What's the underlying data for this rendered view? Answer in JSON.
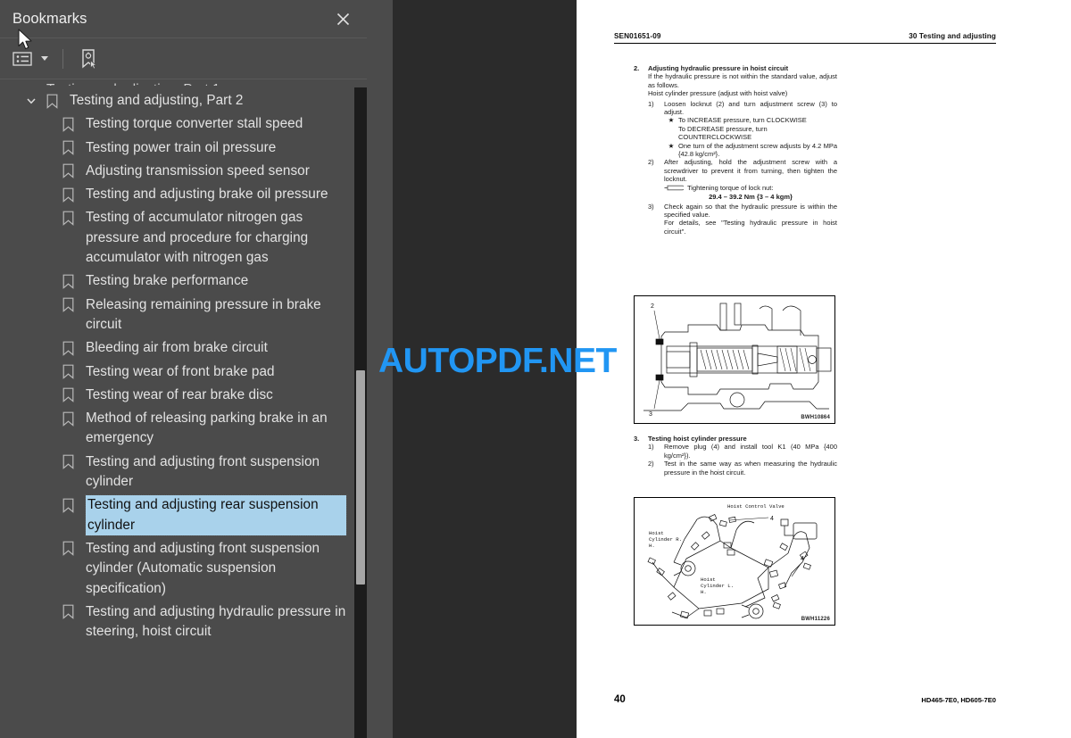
{
  "sidebar": {
    "title": "Bookmarks",
    "close_icon": "close-icon",
    "toolbar": {
      "list_options_icon": "list-options-icon",
      "dropdown_icon": "chevron-down-icon",
      "new_bookmark_icon": "new-bookmark-icon"
    },
    "items": [
      {
        "label": "Testing and adjusting, Part 2",
        "level": 0,
        "expanded": true,
        "selected": false
      },
      {
        "label": "Testing torque converter stall speed",
        "level": 1,
        "selected": false
      },
      {
        "label": "Testing power train oil pressure",
        "level": 1,
        "selected": false
      },
      {
        "label": "Adjusting transmission speed sensor",
        "level": 1,
        "selected": false
      },
      {
        "label": "Testing and adjusting brake oil pressure",
        "level": 1,
        "selected": false
      },
      {
        "label": "Testing of accumulator nitrogen gas pressure and procedure for charging accumulator with nitrogen gas",
        "level": 1,
        "selected": false
      },
      {
        "label": "Testing brake performance",
        "level": 1,
        "selected": false
      },
      {
        "label": "Releasing remaining pressure in brake circuit",
        "level": 1,
        "selected": false
      },
      {
        "label": "Bleeding air from brake circuit",
        "level": 1,
        "selected": false
      },
      {
        "label": "Testing wear of front brake pad",
        "level": 1,
        "selected": false
      },
      {
        "label": "Testing wear of rear brake disc",
        "level": 1,
        "selected": false
      },
      {
        "label": "Method of releasing parking brake in an emergency",
        "level": 1,
        "selected": false
      },
      {
        "label": "Testing and adjusting front suspension cylinder",
        "level": 1,
        "selected": false
      },
      {
        "label": "Testing and adjusting rear suspension cylinder",
        "level": 1,
        "selected": true
      },
      {
        "label": "Testing and adjusting front suspension cylinder (Automatic suspension specification)",
        "level": 1,
        "selected": false
      },
      {
        "label": "Testing and adjusting hydraulic pressure in steering, hoist circuit",
        "level": 1,
        "selected": false
      }
    ],
    "scrollbar": "sidebar-scrollbar"
  },
  "watermark": {
    "text": "AUTOPDF.NET",
    "color": "#2196f3"
  },
  "document": {
    "header": {
      "left": "SEN01651-09",
      "right": "30 Testing and adjusting"
    },
    "footer": {
      "page_number": "40",
      "model_ids": "HD465-7E0, HD605-7E0"
    },
    "sections": [
      {
        "number": "2.",
        "title": "Adjusting hydraulic pressure in hoist circuit",
        "intro": [
          "If the hydraulic pressure is not within the standard value, adjust as follows.",
          "Hoist cylinder pressure (adjust with hoist valve)"
        ],
        "steps": [
          {
            "number": "1)",
            "text": "Loosen locknut (2) and turn adjustment screw (3) to adjust.",
            "bullets": [
              "To INCREASE pressure, turn CLOCKWISE",
              "To DECREASE pressure, turn COUNTERCLOCKWISE",
              "One turn of the adjustment screw adjusts by 4.2 MPa {42.8 kg/cm²}."
            ]
          },
          {
            "number": "2)",
            "text": "After adjusting, hold the adjustment screw with a screwdriver to prevent it from turning, then tighten the locknut.",
            "torque_label": "Tightening torque of lock nut:",
            "torque_value": "29.4 – 39.2 Nm {3 – 4 kgm}"
          },
          {
            "number": "3)",
            "text": "Check again so that the hydraulic pressure is within the specified value.",
            "extra": "For details, see \"Testing hydraulic pressure in hoist circuit\"."
          }
        ]
      },
      {
        "number": "3.",
        "title": "Testing hoist cylinder pressure",
        "steps": [
          {
            "number": "1)",
            "text": "Remove plug (4) and install tool K1 (40 MPa {400 kg/cm²})."
          },
          {
            "number": "2)",
            "text": "Test in the same way as when measuring the hydraulic pressure in the hoist circuit."
          }
        ]
      }
    ],
    "figures": [
      {
        "id": "BWH10864",
        "callouts": [
          "2",
          "3"
        ],
        "labels": []
      },
      {
        "id": "BWH11226",
        "callouts": [
          "4",
          "4"
        ],
        "labels": [
          "Hoist Control Valve",
          "Hoist Cylinder R. H.",
          "Hoist Cylinder L. H."
        ]
      }
    ]
  },
  "cursor": {
    "name": "mouse-pointer"
  }
}
